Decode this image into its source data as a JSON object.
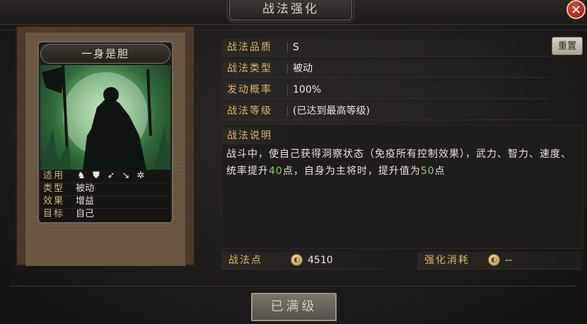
{
  "window": {
    "title": "战法强化",
    "close_icon": "close-icon"
  },
  "skill_card": {
    "name": "一身是胆",
    "stats": [
      {
        "label": "适用",
        "icons": [
          "cavalry-icon",
          "shield-icon",
          "archer-icon",
          "spear-icon",
          "siege-icon"
        ]
      },
      {
        "label": "类型",
        "value": "被动"
      },
      {
        "label": "效果",
        "value": "增益"
      },
      {
        "label": "目标",
        "value": "自己"
      }
    ]
  },
  "info": {
    "rows": [
      {
        "label": "战法品质",
        "value": "S"
      },
      {
        "label": "战法类型",
        "value": "被动"
      },
      {
        "label": "发动概率",
        "value": "100%"
      },
      {
        "label": "战法等级",
        "value": "(已达到最高等级)"
      }
    ],
    "reset_label": "重置",
    "desc_title": "战法说明",
    "desc_parts": {
      "p1": "战斗中，使自己获得洞察状态（免疫所有控制效果），武力、智力、速度、统率提升",
      "n1": "40",
      "p2": "点，自身为主将时，提升值为",
      "n2": "50",
      "p3": "点"
    }
  },
  "points": {
    "label": "战法点",
    "value": "4510"
  },
  "cost": {
    "label": "强化消耗",
    "value": "--"
  },
  "max_button": "已满级",
  "colors": {
    "accent_gold": "#d9b66a",
    "highlight_green": "#7fd07a",
    "close_red": "#c0261e"
  }
}
